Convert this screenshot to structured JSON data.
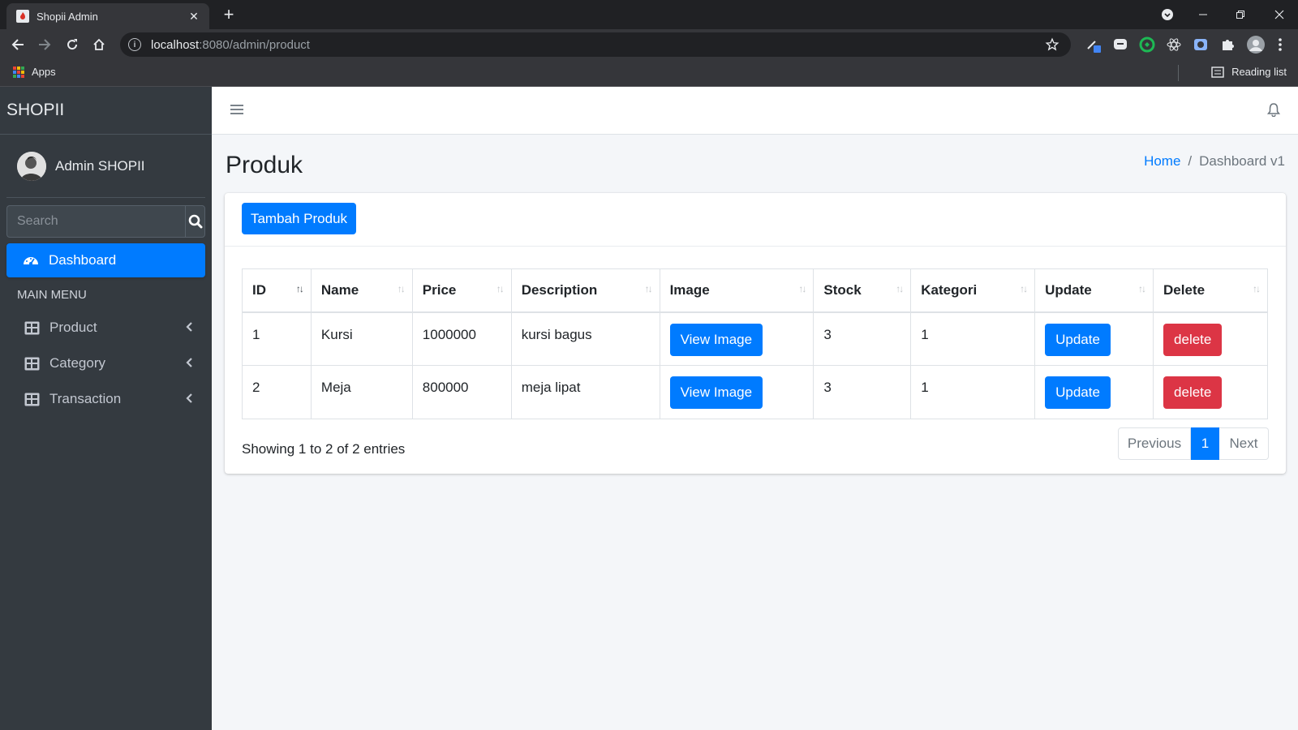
{
  "browser": {
    "tab_title": "Shopii Admin",
    "url_host": "localhost",
    "url_rest": ":8080/admin/product",
    "bookmarks_apps": "Apps",
    "reading_list": "Reading list"
  },
  "sidebar": {
    "brand": "SHOPII",
    "user_name": "Admin SHOPII",
    "search_placeholder": "Search",
    "active_item": "Dashboard",
    "section_header": "MAIN MENU",
    "items": [
      {
        "label": "Product"
      },
      {
        "label": "Category"
      },
      {
        "label": "Transaction"
      }
    ]
  },
  "content": {
    "page_title": "Produk",
    "breadcrumb": {
      "home": "Home",
      "separator": "/",
      "current": "Dashboard v1"
    },
    "add_button": "Tambah Produk",
    "table": {
      "headers": [
        "ID",
        "Name",
        "Price",
        "Description",
        "Image",
        "Stock",
        "Kategori",
        "Update",
        "Delete"
      ],
      "rows": [
        {
          "id": "1",
          "name": "Kursi",
          "price": "1000000",
          "description": "kursi bagus",
          "image_btn": "View Image",
          "stock": "3",
          "kategori": "1",
          "update_btn": "Update",
          "delete_btn": "delete"
        },
        {
          "id": "2",
          "name": "Meja",
          "price": "800000",
          "description": "meja lipat",
          "image_btn": "View Image",
          "stock": "3",
          "kategori": "1",
          "update_btn": "Update",
          "delete_btn": "delete"
        }
      ]
    },
    "info": "Showing 1 to 2 of 2 entries",
    "pagination": {
      "previous": "Previous",
      "current_page": "1",
      "next": "Next"
    }
  },
  "colors": {
    "primary": "#007bff",
    "danger": "#dc3545",
    "sidebar_bg": "#343a40",
    "content_bg": "#f4f6f9"
  }
}
